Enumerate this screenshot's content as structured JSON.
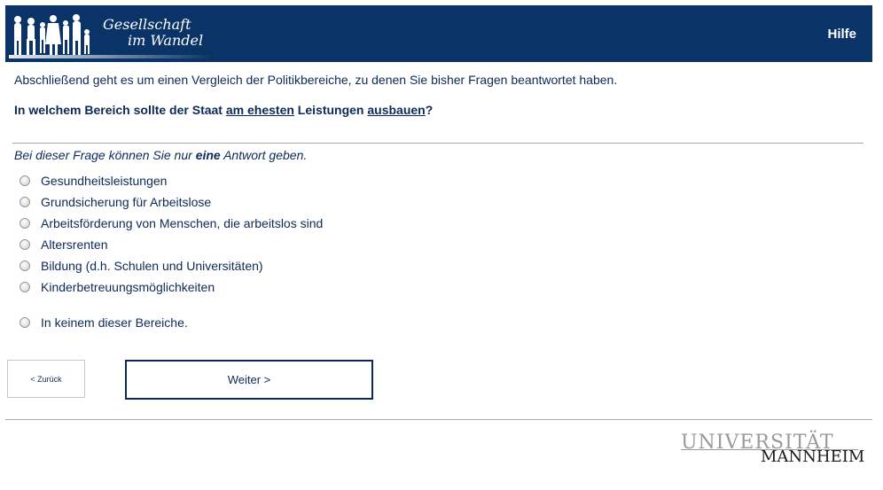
{
  "header": {
    "logo_line1": "Gesellschaft",
    "logo_line2": "im Wandel",
    "help_label": "Hilfe"
  },
  "intro_text": "Abschließend geht es um einen Vergleich der Politikbereiche, zu denen Sie bisher Fragen beantwortet haben.",
  "question": {
    "part1": "In welchem Bereich sollte der Staat ",
    "underline1": "am ehesten",
    "part2": " Leistungen ",
    "underline2": "ausbauen",
    "part3": "?"
  },
  "instruction": {
    "part1": "Bei dieser Frage können Sie nur ",
    "emphasis": "eine",
    "part2": " Antwort geben."
  },
  "options": [
    {
      "label": "Gesundheitsleistungen"
    },
    {
      "label": "Grundsicherung für Arbeitslose"
    },
    {
      "label": "Arbeitsförderung von Menschen, die arbeitslos sind"
    },
    {
      "label": "Altersrenten"
    },
    {
      "label": "Bildung (d.h. Schulen und Universitäten)"
    },
    {
      "label": "Kinderbetreuungsmöglichkeiten"
    },
    {
      "label": "In keinem dieser Bereiche."
    }
  ],
  "nav": {
    "back_label": "< Zurück",
    "next_label": "Weiter >"
  },
  "footer": {
    "university_line1": "UNIVERSITÄT",
    "university_line2": "MANNHEIM"
  },
  "colors": {
    "header_bg": "#0a3468",
    "text": "#0c2a57"
  }
}
